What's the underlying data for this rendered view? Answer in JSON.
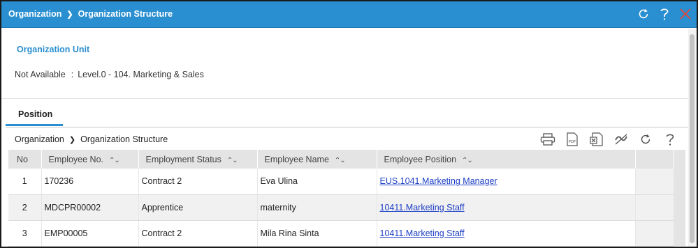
{
  "titlebar": {
    "crumb_root": "Organization",
    "crumb_current": "Organization Structure",
    "icons": [
      "refresh-icon",
      "help-icon",
      "close-icon"
    ]
  },
  "org_unit": {
    "header": "Organization Unit",
    "label": "Not Available",
    "colon": ":",
    "value": "Level.0 - 104. Marketing & Sales"
  },
  "tabs": [
    {
      "label": "Position",
      "active": true
    }
  ],
  "inner_breadcrumb": {
    "root": "Organization",
    "current": "Organization Structure"
  },
  "toolbar": {
    "icons": [
      "print-icon",
      "pdf-icon",
      "excel-icon",
      "filter-clear-icon",
      "refresh-icon",
      "help-icon"
    ]
  },
  "table": {
    "columns": [
      "No",
      "Employee No.",
      "Employment Status",
      "Employee Name",
      "Employee Position"
    ],
    "sort_glyph": "^v",
    "rows": [
      {
        "no": "1",
        "employee_no": "170236",
        "status": "Contract 2",
        "name": "Eva Ulina",
        "position": "EUS.1041.Marketing Manager"
      },
      {
        "no": "2",
        "employee_no": "MDCPR00002",
        "status": "Apprentice",
        "name": "maternity",
        "position": "10411.Marketing Staff"
      },
      {
        "no": "3",
        "employee_no": "EMP00005",
        "status": "Contract 2",
        "name": "Mila Rina Sinta",
        "position": "10411.Marketing Staff"
      }
    ]
  },
  "colors": {
    "titlebar_bg": "#2a8fd0",
    "accent": "#2a8fd0",
    "link": "#1c3fc4",
    "close": "#e0463a"
  }
}
